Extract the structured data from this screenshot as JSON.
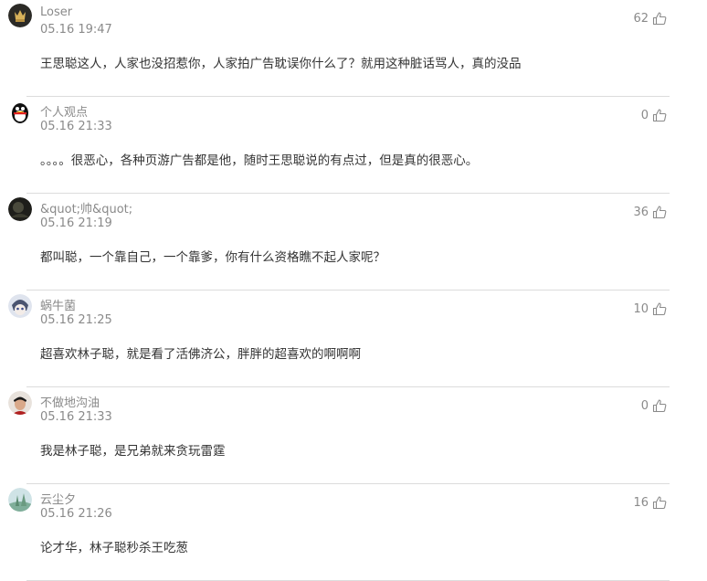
{
  "comments": [
    {
      "username": "Loser",
      "time": "05.16 19:47",
      "text": "王思聪这人，人家也没招惹你，人家拍广告耽误你什么了？就用这种脏话骂人，真的没品",
      "likes": "62",
      "avatar": "crown-avatar"
    },
    {
      "username": "个人观点",
      "time": "05.16 21:33",
      "text": "。。。。很恶心，各种页游广告都是他，随时王思聪说的有点过，但是真的很恶心。",
      "likes": "0",
      "avatar": "penguin-avatar"
    },
    {
      "username": "&quot;帅&quot;",
      "time": "05.16 21:19",
      "text": "都叫聪，一个靠自己，一个靠爹，你有什么资格瞧不起人家呢？",
      "likes": "36",
      "avatar": "dark-photo-avatar"
    },
    {
      "username": "蜗牛菌",
      "time": "05.16 21:25",
      "text": "超喜欢林子聪，就是看了活佛济公，胖胖的超喜欢的啊啊啊",
      "likes": "10",
      "avatar": "anime-avatar"
    },
    {
      "username": "不做地沟油",
      "time": "05.16 21:33",
      "text": "我是林子聪，是兄弟就来贪玩雷霆",
      "likes": "0",
      "avatar": "person-photo-avatar"
    },
    {
      "username": "云尘夕",
      "time": "05.16 21:26",
      "text": "论才华，林子聪秒杀王吃葱",
      "likes": "16",
      "avatar": "landscape-avatar"
    }
  ],
  "icons": {
    "like": "thumbs-up-icon"
  }
}
